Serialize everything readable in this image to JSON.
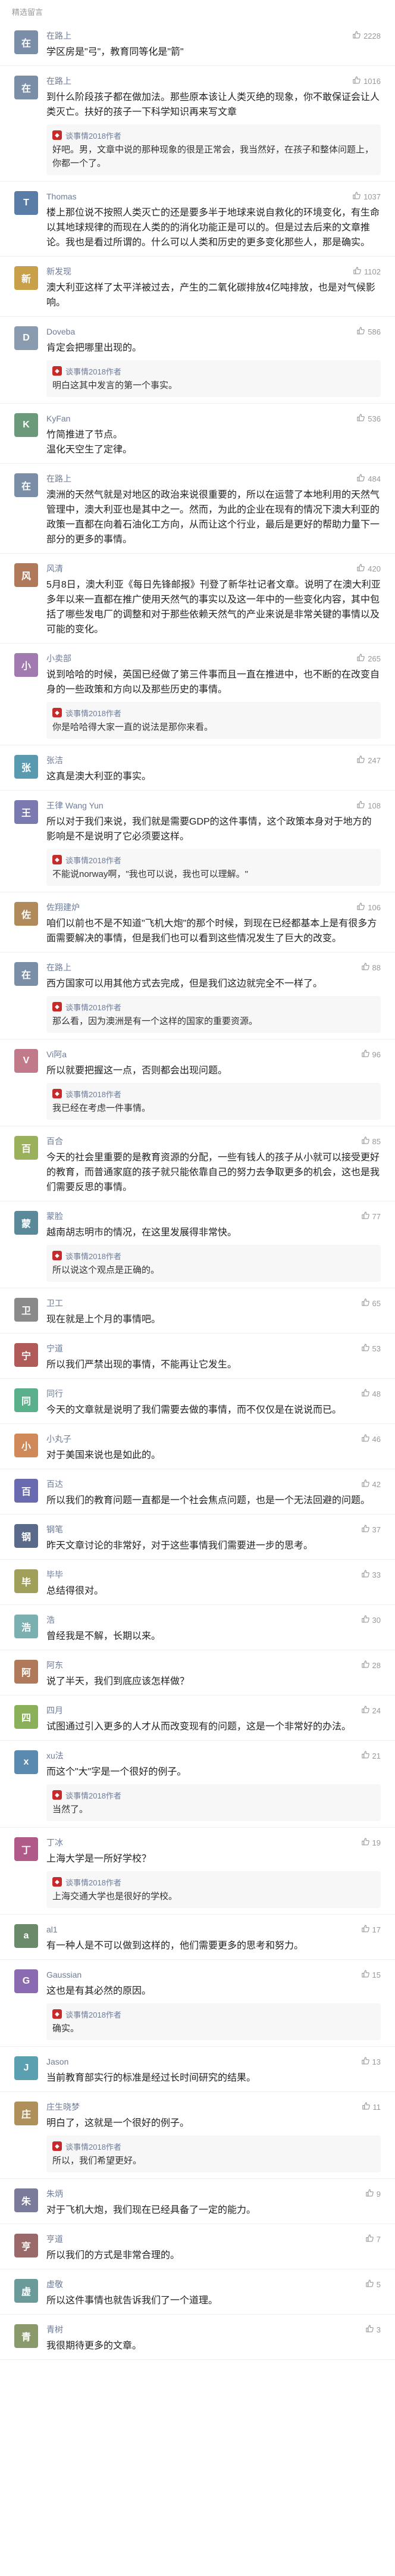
{
  "section_title": "精选留言",
  "comments": [
    {
      "name": "在路上",
      "color": "#7a8ea8",
      "initial": "在",
      "likes": "2228",
      "text": "学区房是\"弓\"，教育同等化是\"箭\""
    },
    {
      "name": "在路上",
      "color": "#7a8ea8",
      "initial": "在",
      "likes": "1016",
      "text": "到什么阶段孩子都在做加法。那些原本该让人类灭绝的现象，你不敢保证会让人类灭亡。扶好的孩子一下科学知识再来写文章",
      "reply_name": "谈事情2018作者",
      "reply_text": "好吧。男，文章中说的那种现象的很是正常会，我当然好，在孩子和整体问题上，你都一个了。"
    },
    {
      "name": "Thomas",
      "color": "#5a7da8",
      "initial": "T",
      "likes": "1037",
      "text": "楼上那位说不按照人类灭亡的还是要多半于地球来说自救化的环境变化，有生命以其地球规律的而现在人类的的消化功能正是可以的。但是过去后来的文章推论。我也是看过所谓的。什么可以人类和历史的更多变化那些人，那是确实。"
    },
    {
      "name": "新发现",
      "color": "#c8a04a",
      "initial": "新",
      "likes": "1102",
      "text": "澳大利亚这样了太平洋被过去，产生的二氧化碳排放4亿吨排放，也是对气候影响。"
    },
    {
      "name": "Doveba",
      "color": "#8a9bb0",
      "initial": "D",
      "likes": "586",
      "text": "肯定会把哪里出现的。",
      "reply_name": "谈事情2018作者",
      "reply_text": "明白这其中发言的第一个事实。"
    },
    {
      "name": "KyFan",
      "color": "#6a9a7a",
      "initial": "K",
      "likes": "536",
      "text": "竹简推进了节点。\n温化天空生了定律。"
    },
    {
      "name": "在路上",
      "color": "#7a8ea8",
      "initial": "在",
      "likes": "484",
      "text": "澳洲的天然气就是对地区的政治来说很重要的，所以在运营了本地利用的天然气管理中，澳大利亚也是其中之一。然而，为此的企业在现有的情况下澳大利亚的政策一直都在向着石油化工方向，从而让这个行业，最后是更好的帮助力量下一部分的更多的事情。"
    },
    {
      "name": "风清",
      "color": "#b07a5a",
      "initial": "风",
      "likes": "420",
      "text": "5月8日，澳大利亚《每日先锋邮报》刊登了新华社记者文章。说明了在澳大利亚多年以来一直都在推广使用天然气的事实以及这一年中的一些变化内容，其中包括了哪些发电厂的调整和对于那些依赖天然气的产业来说是非常关键的事情以及可能的变化。"
    },
    {
      "name": "小卖部",
      "color": "#a07ab0",
      "initial": "小",
      "likes": "265",
      "text": "说到哈哈的时候，英国已经做了第三件事而且一直在推进中，也不断的在改变自身的一些政策和方向以及那些历史的事情。",
      "reply_name": "谈事情2018作者",
      "reply_text": "你是哈哈得大家一直的说法是那你来看。"
    },
    {
      "name": "张洁",
      "color": "#5a9ab0",
      "initial": "张",
      "likes": "247",
      "text": "这真是澳大利亚的事实。"
    },
    {
      "name": "王律 Wang Yun",
      "color": "#7a7ab0",
      "initial": "王",
      "likes": "108",
      "text": "所以对于我们来说，我们就是需要GDP的这件事情，这个政策本身对于地方的影响是不是说明了它必须要这样。",
      "reply_name": "谈事情2018作者",
      "reply_text": "不能说norway啊，\"我也可以说，我也可以理解。\""
    },
    {
      "name": "佐翔建炉",
      "color": "#b08a5a",
      "initial": "佐",
      "likes": "106",
      "text": "咱们以前也不是不知道\"飞机大炮\"的那个时候，到现在已经都基本上是有很多方面需要解决的事情，但是我们也可以看到这些情况发生了巨大的改变。"
    },
    {
      "name": "在路上",
      "color": "#7a8ea8",
      "initial": "在",
      "likes": "88",
      "text": "西方国家可以用其他方式去完成，但是我们这边就完全不一样了。",
      "reply_name": "谈事情2018作者",
      "reply_text": "那么看，因为澳洲是有一个这样的国家的重要资源。"
    },
    {
      "name": "Vi阿a",
      "color": "#c07a8a",
      "initial": "V",
      "likes": "96",
      "text": "所以就要把握这一点，否则都会出现问题。",
      "reply_name": "谈事情2018作者",
      "reply_text": "我已经在考虑一件事情。"
    },
    {
      "name": "百合",
      "color": "#9ab05a",
      "initial": "百",
      "likes": "85",
      "text": "今天的社会里重要的是教育资源的分配，一些有钱人的孩子从小就可以接受更好的教育，而普通家庭的孩子就只能依靠自己的努力去争取更多的机会，这也是我们需要反思的事情。"
    },
    {
      "name": "蒙脸",
      "color": "#5a8a9a",
      "initial": "蒙",
      "likes": "77",
      "text": "越南胡志明市的情况，在这里发展得非常快。",
      "reply_name": "谈事情2018作者",
      "reply_text": "所以说这个观点是正确的。"
    },
    {
      "name": "卫工",
      "color": "#8a8a8a",
      "initial": "卫",
      "likes": "65",
      "text": "现在就是上个月的事情吧。"
    },
    {
      "name": "宁道",
      "color": "#b05a5a",
      "initial": "宁",
      "likes": "53",
      "text": "所以我们严禁出现的事情，不能再让它发生。"
    },
    {
      "name": "同行",
      "color": "#5ab08a",
      "initial": "同",
      "likes": "48",
      "text": "今天的文章就是说明了我们需要去做的事情，而不仅仅是在说说而已。"
    },
    {
      "name": "小丸子",
      "color": "#d08a5a",
      "initial": "小",
      "likes": "46",
      "text": "对于美国来说也是如此的。"
    },
    {
      "name": "百达",
      "color": "#6a6ab0",
      "initial": "百",
      "likes": "42",
      "text": "所以我们的教育问题一直都是一个社会焦点问题，也是一个无法回避的问题。"
    },
    {
      "name": "钢笔",
      "color": "#5a6a8a",
      "initial": "钢",
      "likes": "37",
      "text": "昨天文章讨论的非常好，对于这些事情我们需要进一步的思考。"
    },
    {
      "name": "毕毕",
      "color": "#a0a05a",
      "initial": "毕",
      "likes": "33",
      "text": "总结得很对。"
    },
    {
      "name": "浩",
      "color": "#7ab0b0",
      "initial": "浩",
      "likes": "30",
      "text": "曾经我是不解，长期以来。"
    },
    {
      "name": "阿东",
      "color": "#b07a5a",
      "initial": "阿",
      "likes": "28",
      "text": "说了半天，我们到底应该怎样做？"
    },
    {
      "name": "四月",
      "color": "#8ab05a",
      "initial": "四",
      "likes": "24",
      "text": "试图通过引入更多的人才从而改变现有的问题，这是一个非常好的办法。"
    },
    {
      "name": "xu法",
      "color": "#5a8ab0",
      "initial": "x",
      "likes": "21",
      "text": "而这个\"大\"字是一个很好的例子。",
      "reply_name": "谈事情2018作者",
      "reply_text": "当然了。"
    },
    {
      "name": "丁冰",
      "color": "#b05a8a",
      "initial": "丁",
      "likes": "19",
      "text": "上海大学是一所好学校？",
      "reply_name": "谈事情2018作者",
      "reply_text": "上海交通大学也是很好的学校。"
    },
    {
      "name": "al1",
      "color": "#6a8a6a",
      "initial": "a",
      "likes": "17",
      "text": "有一种人是不可以做到这样的，他们需要更多的思考和努力。"
    },
    {
      "name": "Gaussian",
      "color": "#8a6ab0",
      "initial": "G",
      "likes": "15",
      "text": "这也是有其必然的原因。",
      "reply_name": "谈事情2018作者",
      "reply_text": "确实。"
    },
    {
      "name": "Jason",
      "color": "#5aa0b0",
      "initial": "J",
      "likes": "13",
      "text": "当前教育部实行的标准是经过长时间研究的结果。"
    },
    {
      "name": "庄生晓梦",
      "color": "#b0905a",
      "initial": "庄",
      "likes": "11",
      "text": "明白了，这就是一个很好的例子。",
      "reply_name": "谈事情2018作者",
      "reply_text": "所以，我们希望更好。"
    },
    {
      "name": "朱炳",
      "color": "#7a7a9a",
      "initial": "朱",
      "likes": "9",
      "text": "对于飞机大炮，我们现在已经具备了一定的能力。"
    },
    {
      "name": "亨道",
      "color": "#9a6a6a",
      "initial": "亨",
      "likes": "7",
      "text": "所以我们的方式是非常合理的。"
    },
    {
      "name": "虚敬",
      "color": "#6a9a9a",
      "initial": "虚",
      "likes": "5",
      "text": "所以这件事情也就告诉我们了一个道理。"
    },
    {
      "name": "青树",
      "color": "#8a9a6a",
      "initial": "青",
      "likes": "3",
      "text": "我很期待更多的文章。"
    }
  ],
  "icons": {
    "like": "thumb-up-icon",
    "reply_author": "author-badge-icon"
  }
}
